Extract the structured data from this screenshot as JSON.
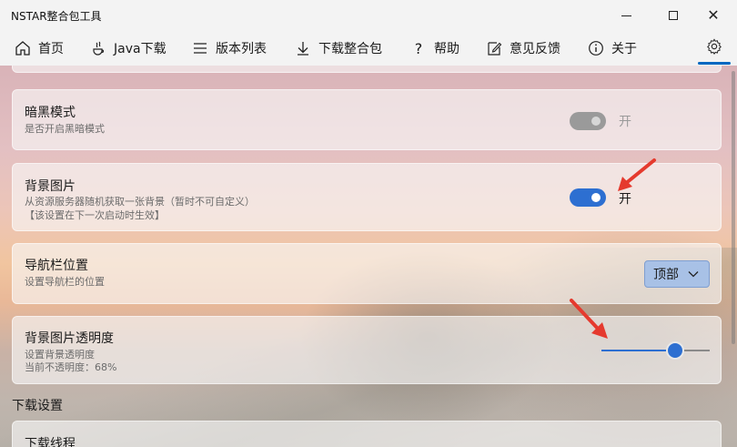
{
  "window": {
    "title": "NSTAR整合包工具"
  },
  "nav": {
    "home": "首页",
    "java": "Java下载",
    "versions": "版本列表",
    "download_pack": "下载整合包",
    "help": "帮助",
    "feedback": "意见反馈",
    "about": "关于"
  },
  "settings": {
    "dark_mode": {
      "title": "暗黑模式",
      "desc": "是否开启黑暗模式",
      "state_label": "开",
      "enabled": false
    },
    "background_image": {
      "title": "背景图片",
      "desc_line1": "从资源服务器随机获取一张背景（暂时不可自定义）",
      "desc_line2": "【该设置在下一次启动时生效】",
      "state_label": "开",
      "enabled": true
    },
    "nav_position": {
      "title": "导航栏位置",
      "desc": "设置导航栏的位置",
      "selected": "顶部"
    },
    "bg_opacity": {
      "title": "背景图片透明度",
      "desc_line1": "设置背景透明度",
      "desc_line2": "当前不透明度：68%",
      "value": 0.68
    }
  },
  "download_section": {
    "header": "下载设置",
    "first_item_title": "下载线程"
  },
  "colors": {
    "accent": "#2d6fd1",
    "annotation_arrow": "#e53a2e"
  }
}
